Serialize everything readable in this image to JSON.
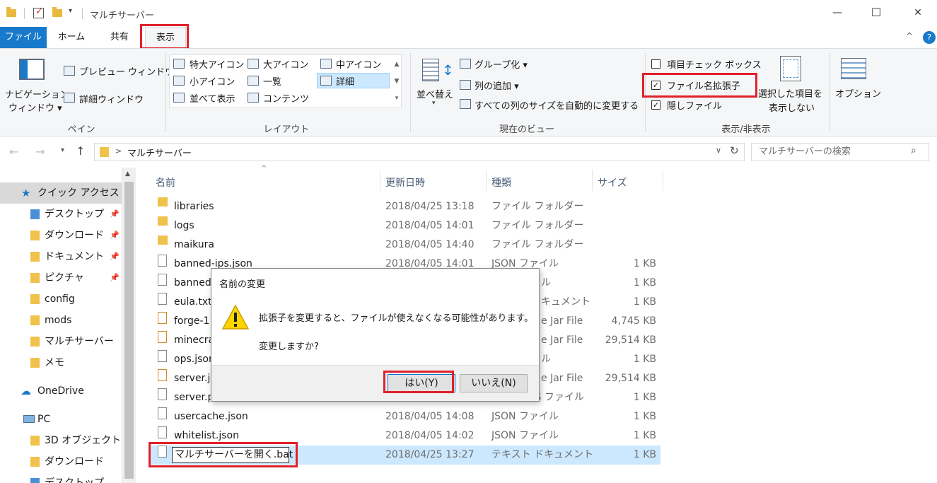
{
  "window": {
    "title": "マルチサーバー",
    "controls": {
      "minimize": "—",
      "maximize": "☐",
      "close": "✕"
    }
  },
  "tabs": {
    "file": "ファイル",
    "home": "ホーム",
    "share": "共有",
    "view": "表示"
  },
  "ribbon": {
    "pane": {
      "label": "ペイン",
      "nav_pane_l1": "ナビゲーション",
      "nav_pane_l2": "ウィンドウ",
      "preview": "プレビュー ウィンドウ",
      "details": "詳細ウィンドウ"
    },
    "layout": {
      "label": "レイアウト",
      "extra_large": "特大アイコン",
      "large": "大アイコン",
      "medium": "中アイコン",
      "small": "小アイコン",
      "list": "一覧",
      "details": "詳細",
      "tiles": "並べて表示",
      "content": "コンテンツ"
    },
    "current_view": {
      "label": "現在のビュー",
      "sort": "並べ替え",
      "group": "グループ化",
      "add_column": "列の追加",
      "fit_columns": "すべての列のサイズを自動的に変更する"
    },
    "show_hide": {
      "label": "表示/非表示",
      "item_checkbox": "項目チェック ボックス",
      "extensions": "ファイル名拡張子",
      "hidden": "隠しファイル",
      "hide_selected_l1": "選択した項目を",
      "hide_selected_l2": "表示しない"
    },
    "options": "オプション"
  },
  "address": {
    "path": "マルチサーバー",
    "search_placeholder": "マルチサーバーの検索"
  },
  "nav": {
    "quick_access": "クイック アクセス",
    "desktop": "デスクトップ",
    "downloads": "ダウンロード",
    "documents": "ドキュメント",
    "pictures": "ピクチャ",
    "config": "config",
    "mods": "mods",
    "multiserver": "マルチサーバー",
    "memo": "メモ",
    "onedrive": "OneDrive",
    "pc": "PC",
    "objects3d": "3D オブジェクト",
    "pc_downloads": "ダウンロード",
    "pc_desktop": "デスクトップ"
  },
  "columns": {
    "name": "名前",
    "date": "更新日時",
    "type": "種類",
    "size": "サイズ"
  },
  "files": [
    {
      "name": "libraries",
      "date": "2018/04/25 13:18",
      "type": "ファイル フォルダー",
      "size": ""
    },
    {
      "name": "logs",
      "date": "2018/04/05 14:01",
      "type": "ファイル フォルダー",
      "size": ""
    },
    {
      "name": "maikura",
      "date": "2018/04/05 14:40",
      "type": "ファイル フォルダー",
      "size": ""
    },
    {
      "name": "banned-ips.json",
      "date": "2018/04/05 14:01",
      "type": "JSON ファイル",
      "size": "1 KB"
    },
    {
      "name": "banned-",
      "date": "",
      "type": "ル",
      "size": "1 KB"
    },
    {
      "name": "eula.txt",
      "date": "",
      "type": "キュメント",
      "size": "1 KB"
    },
    {
      "name": "forge-1.",
      "date": "",
      "type": "e Jar File",
      "size": "4,745 KB"
    },
    {
      "name": "minecra",
      "date": "",
      "type": "e Jar File",
      "size": "29,514 KB"
    },
    {
      "name": "ops.json",
      "date": "",
      "type": "ル",
      "size": "1 KB"
    },
    {
      "name": "server.ja",
      "date": "",
      "type": "e Jar File",
      "size": "29,514 KB"
    },
    {
      "name": "server.pr",
      "date": "",
      "type": "TIES ファイル",
      "size": "1 KB"
    },
    {
      "name": "usercache.json",
      "date": "2018/04/05 14:08",
      "type": "JSON ファイル",
      "size": "1 KB"
    },
    {
      "name": "whitelist.json",
      "date": "2018/04/05 14:02",
      "type": "JSON ファイル",
      "size": "1 KB"
    },
    {
      "name": "マルチサーバーを開く.bat",
      "date": "2018/04/25 13:27",
      "type": "テキスト ドキュメント",
      "size": "1 KB"
    }
  ],
  "dialog": {
    "title": "名前の変更",
    "message": "拡張子を変更すると、ファイルが使えなくなる可能性があります。",
    "question": "変更しますか?",
    "yes": "はい(Y)",
    "no": "いいえ(N)"
  },
  "colors": {
    "accent": "#1979ca",
    "highlight": "#e0202a",
    "selection": "#cce8ff"
  }
}
